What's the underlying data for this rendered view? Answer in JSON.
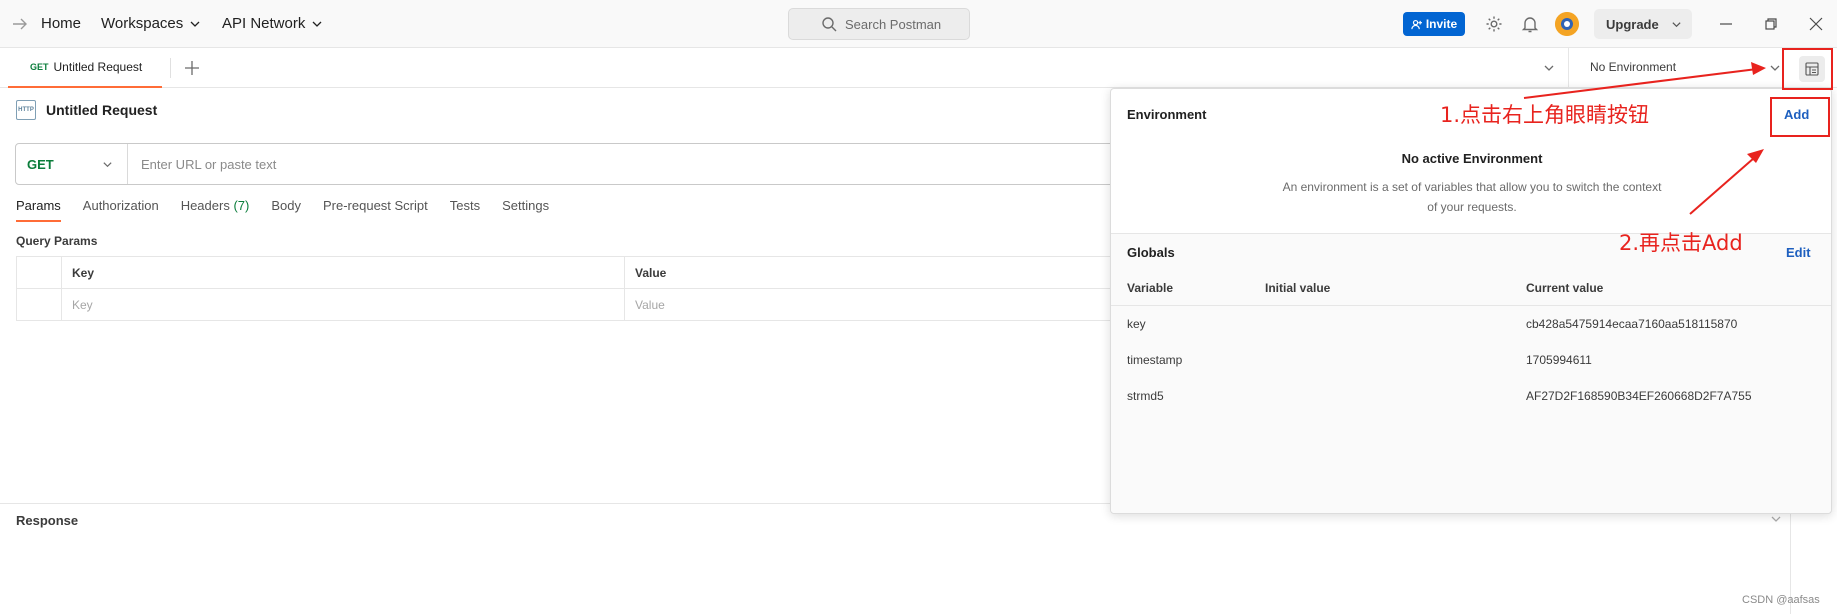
{
  "header": {
    "nav": {
      "home": "Home",
      "workspaces": "Workspaces",
      "api_network": "API Network"
    },
    "search_placeholder": "Search Postman",
    "invite_label": "Invite",
    "upgrade_label": "Upgrade"
  },
  "tabs": {
    "active_tab": {
      "method": "GET",
      "title": "Untitled Request"
    },
    "environment_selector": "No Environment"
  },
  "request": {
    "title": "Untitled Request",
    "method": "GET",
    "url_placeholder": "Enter URL or paste text",
    "subtabs": [
      {
        "label": "Params",
        "active": true
      },
      {
        "label": "Authorization"
      },
      {
        "label": "Headers",
        "count": "(7)"
      },
      {
        "label": "Body"
      },
      {
        "label": "Pre-request Script"
      },
      {
        "label": "Tests"
      },
      {
        "label": "Settings"
      }
    ],
    "query_params": {
      "label": "Query Params",
      "headers": [
        "Key",
        "Value"
      ],
      "placeholders": [
        "Key",
        "Value"
      ]
    }
  },
  "response": {
    "label": "Response"
  },
  "environment_panel": {
    "title": "Environment",
    "add_label": "Add",
    "empty_title": "No active Environment",
    "empty_description": "An environment is a set of variables that allow you to switch the context of your requests.",
    "globals_title": "Globals",
    "edit_label": "Edit",
    "columns": [
      "Variable",
      "Initial value",
      "Current value"
    ],
    "variables": [
      {
        "variable": "key",
        "initial": "",
        "current": "cb428a5475914ecaa7160aa518115870"
      },
      {
        "variable": "timestamp",
        "initial": "",
        "current": "1705994611"
      },
      {
        "variable": "strmd5",
        "initial": "",
        "current": "AF27D2F168590B34EF260668D2F7A755"
      }
    ]
  },
  "annotations": {
    "step1": "1.点击右上角眼睛按钮",
    "step2": "2.再点击Add",
    "color": "#e8231e"
  },
  "watermark": "CSDN @aafsas",
  "colors": {
    "accent": "#ff6c37",
    "invite": "#0265d2",
    "get_method": "#0b7d3b",
    "link": "#1d5fbf"
  }
}
